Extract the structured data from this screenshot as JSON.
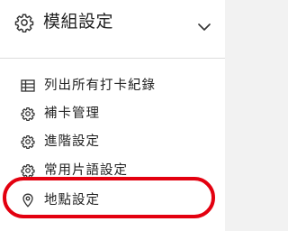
{
  "header": {
    "title": "模組設定",
    "icon": "gear-icon",
    "chevron": "chevron-down-icon"
  },
  "menu": {
    "items": [
      {
        "label": "列出所有打卡紀錄",
        "icon": "table-icon"
      },
      {
        "label": "補卡管理",
        "icon": "gear-icon"
      },
      {
        "label": "進階設定",
        "icon": "gear-icon"
      },
      {
        "label": "常用片語設定",
        "icon": "gear-icon"
      },
      {
        "label": "地點設定",
        "icon": "location-pin-icon"
      }
    ]
  },
  "colors": {
    "highlight": "#e3000f",
    "text": "#222222",
    "divider": "#dddddd"
  }
}
